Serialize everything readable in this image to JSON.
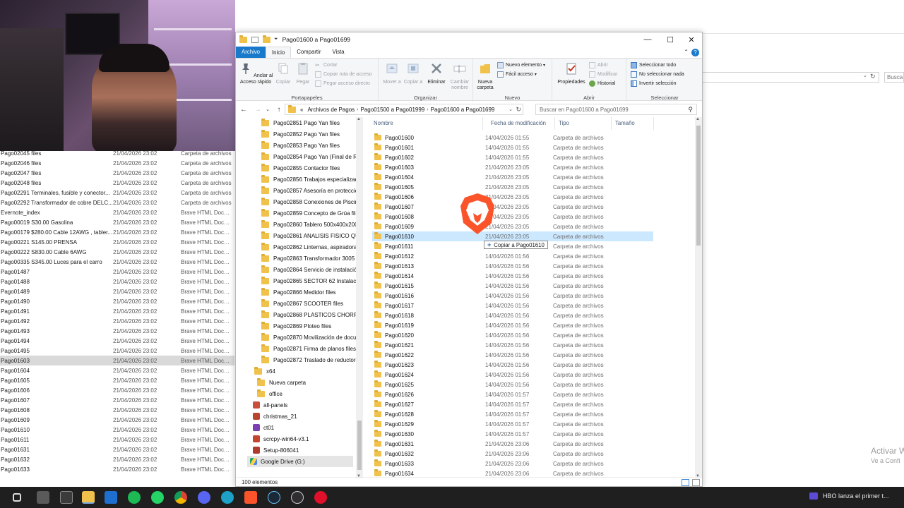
{
  "background_window": {
    "rows": [
      {
        "name": "Pago02045 files",
        "date": "21/04/2026 23:02",
        "type": "Carpeta de archivos"
      },
      {
        "name": "Pago02046 files",
        "date": "21/04/2026 23:02",
        "type": "Carpeta de archivos"
      },
      {
        "name": "Pago02047 files",
        "date": "21/04/2026 23:02",
        "type": "Carpeta de archivos"
      },
      {
        "name": "Pago02048 files",
        "date": "21/04/2026 23:02",
        "type": "Carpeta de archivos"
      },
      {
        "name": "Pago02291 Terminales, fusible y conector...",
        "date": "21/04/2026 23:02",
        "type": "Carpeta de archivos"
      },
      {
        "name": "Pago02292 Transformador de cobre DELC...",
        "date": "21/04/2026 23:02",
        "type": "Carpeta de archivos"
      },
      {
        "name": "Evernote_index",
        "date": "21/04/2026 23:02",
        "type": "Brave HTML Docu..."
      },
      {
        "name": "Pago00019 S30.00 Gasolina",
        "date": "21/04/2026 23:02",
        "type": "Brave HTML Docu..."
      },
      {
        "name": "Pago00179 $280.00 Cable 12AWG , tabler...",
        "date": "21/04/2026 23:02",
        "type": "Brave HTML Docu..."
      },
      {
        "name": "Pago00221 S145.00 PRENSA",
        "date": "21/04/2026 23:02",
        "type": "Brave HTML Docu..."
      },
      {
        "name": "Pago00222 S830.00 Cable 6AWG",
        "date": "21/04/2026 23:02",
        "type": "Brave HTML Docu..."
      },
      {
        "name": "Pago00335 S345.00 Luces para el carro",
        "date": "21/04/2026 23:02",
        "type": "Brave HTML Docu..."
      },
      {
        "name": "Pago01487",
        "date": "21/04/2026 23:02",
        "type": "Brave HTML Docu..."
      },
      {
        "name": "Pago01488",
        "date": "21/04/2026 23:02",
        "type": "Brave HTML Docu..."
      },
      {
        "name": "Pago01489",
        "date": "21/04/2026 23:02",
        "type": "Brave HTML Docu..."
      },
      {
        "name": "Pago01490",
        "date": "21/04/2026 23:02",
        "type": "Brave HTML Docu..."
      },
      {
        "name": "Pago01491",
        "date": "21/04/2026 23:02",
        "type": "Brave HTML Docu..."
      },
      {
        "name": "Pago01492",
        "date": "21/04/2026 23:02",
        "type": "Brave HTML Docu..."
      },
      {
        "name": "Pago01493",
        "date": "21/04/2026 23:02",
        "type": "Brave HTML Docu..."
      },
      {
        "name": "Pago01494",
        "date": "21/04/2026 23:02",
        "type": "Brave HTML Docu..."
      },
      {
        "name": "Pago01495",
        "date": "21/04/2026 23:02",
        "type": "Brave HTML Docu..."
      },
      {
        "name": "Pago01603",
        "date": "21/04/2026 23:02",
        "type": "Brave HTML Docu...",
        "selected": true
      },
      {
        "name": "Pago01604",
        "date": "21/04/2026 23:02",
        "type": "Brave HTML Docu..."
      },
      {
        "name": "Pago01605",
        "date": "21/04/2026 23:02",
        "type": "Brave HTML Docu..."
      },
      {
        "name": "Pago01606",
        "date": "21/04/2026 23:02",
        "type": "Brave HTML Docu..."
      },
      {
        "name": "Pago01607",
        "date": "21/04/2026 23:02",
        "type": "Brave HTML Docu..."
      },
      {
        "name": "Pago01608",
        "date": "21/04/2026 23:02",
        "type": "Brave HTML Docu..."
      },
      {
        "name": "Pago01609",
        "date": "21/04/2026 23:02",
        "type": "Brave HTML Docu..."
      },
      {
        "name": "Pago01610",
        "date": "21/04/2026 23:02",
        "type": "Brave HTML Docu..."
      },
      {
        "name": "Pago01611",
        "date": "21/04/2026 23:02",
        "type": "Brave HTML Docu..."
      },
      {
        "name": "Pago01631",
        "date": "21/04/2026 23:02",
        "type": "Brave HTML Docu..."
      },
      {
        "name": "Pago01632",
        "date": "21/04/2026 23:02",
        "type": "Brave HTML Docu..."
      },
      {
        "name": "Pago01633",
        "date": "21/04/2026 23:02",
        "type": "Brave HTML Docu..."
      }
    ],
    "search_placeholder": "Busca",
    "watermark_line1": "Activar W",
    "watermark_line2": "Ve a Confi"
  },
  "window": {
    "title": "Pago01600 a Pago01699",
    "minimize": "—",
    "maximize": "☐",
    "close": "✕"
  },
  "ribbon_tabs": [
    "Archivo",
    "Inicio",
    "Compartir",
    "Vista"
  ],
  "ribbon": {
    "portapapeles": {
      "label": "Portapapeles",
      "pin": "Anclar al Acceso rápido",
      "copy": "Copiar",
      "paste": "Pegar",
      "cut": "Cortar",
      "copy_path": "Copiar ruta de acceso",
      "paste_shortcut": "Pegar acceso directo"
    },
    "organizar": {
      "label": "Organizar",
      "move": "Mover a",
      "copy_to": "Copiar a",
      "delete": "Eliminar",
      "rename": "Cambiar nombre"
    },
    "nuevo": {
      "label": "Nuevo",
      "new_folder": "Nueva carpeta",
      "new_item": "Nuevo elemento",
      "easy_access": "Fácil acceso"
    },
    "abrir": {
      "label": "Abrir",
      "properties": "Propiedades",
      "open": "Abrir",
      "edit": "Modificar",
      "history": "Historial"
    },
    "seleccionar": {
      "label": "Seleccionar",
      "select_all": "Seleccionar todo",
      "select_none": "No seleccionar nada",
      "invert": "Invertir selección"
    }
  },
  "address": {
    "prefix": "«",
    "crumbs": [
      "Archivos de Pagos",
      "Pago01500 a Pago01999",
      "Pago01600 a Pago01699"
    ],
    "search_placeholder": "Buscar en Pago01600 a Pago01699"
  },
  "nav_tree": [
    {
      "label": "Pago02851 Pago Yan files",
      "kind": "folder"
    },
    {
      "label": "Pago02852 Pago Yan files",
      "kind": "folder"
    },
    {
      "label": "Pago02853 Pago Yan files",
      "kind": "folder"
    },
    {
      "label": "Pago02854 Pago Yan (Final de ROE",
      "kind": "folder"
    },
    {
      "label": "Pago02855 Contactor files",
      "kind": "folder"
    },
    {
      "label": "Pago02856 Trabajos especializado",
      "kind": "folder"
    },
    {
      "label": "Pago02857 Asesoría en protección",
      "kind": "folder"
    },
    {
      "label": "Pago02858 Conexiones de Piscina",
      "kind": "folder"
    },
    {
      "label": "Pago02859 Concepto de Grúa files",
      "kind": "folder"
    },
    {
      "label": "Pago02860 Tablero 500x400x200 , I",
      "kind": "folder"
    },
    {
      "label": "Pago02861 ANALISIS FISICO QUIM",
      "kind": "folder"
    },
    {
      "label": "Pago02862 Linternas, aspiradora, H",
      "kind": "folder"
    },
    {
      "label": "Pago02863 Transformador 3005 fil",
      "kind": "folder"
    },
    {
      "label": "Pago02864 Servicio de instalación",
      "kind": "folder"
    },
    {
      "label": "Pago02865 SECTOR 62 Instalación",
      "kind": "folder"
    },
    {
      "label": "Pago02866 Medidor files",
      "kind": "folder"
    },
    {
      "label": "Pago02867 SCOOTER files",
      "kind": "folder"
    },
    {
      "label": "Pago02868 PLASTICOS CHORRILL",
      "kind": "folder"
    },
    {
      "label": "Pago02869 Ploteo files",
      "kind": "folder"
    },
    {
      "label": "Pago02870 Movilización de docun",
      "kind": "folder"
    },
    {
      "label": "Pago02871 Firma de planos files",
      "kind": "folder"
    },
    {
      "label": "Pago02872 Traslado de reductores",
      "kind": "folder"
    },
    {
      "label": "x64",
      "kind": "folder"
    },
    {
      "label": "Nueva carpeta",
      "kind": "folder"
    },
    {
      "label": "office",
      "kind": "folder"
    },
    {
      "label": "all-panels",
      "kind": "app"
    },
    {
      "label": "christmas_21",
      "kind": "app"
    },
    {
      "label": "ct01",
      "kind": "app"
    },
    {
      "label": "scrcpy-win64-v3.1",
      "kind": "app"
    },
    {
      "label": "Setup-806041",
      "kind": "app"
    },
    {
      "label": "Google Drive (G:)",
      "kind": "drive"
    }
  ],
  "columns": {
    "name": "Nombre",
    "date": "Fecha de modificación",
    "type": "Tipo",
    "size": "Tamaño"
  },
  "files": [
    {
      "name": "Pago01600",
      "date": "14/04/2026 01:55",
      "type": "Carpeta de archivos"
    },
    {
      "name": "Pago01601",
      "date": "14/04/2026 01:55",
      "type": "Carpeta de archivos"
    },
    {
      "name": "Pago01602",
      "date": "14/04/2026 01:55",
      "type": "Carpeta de archivos"
    },
    {
      "name": "Pago01603",
      "date": "21/04/2026 23:05",
      "type": "Carpeta de archivos"
    },
    {
      "name": "Pago01604",
      "date": "21/04/2026 23:05",
      "type": "Carpeta de archivos"
    },
    {
      "name": "Pago01605",
      "date": "21/04/2026 23:05",
      "type": "Carpeta de archivos"
    },
    {
      "name": "Pago01606",
      "date": "21/04/2026 23:05",
      "type": "Carpeta de archivos"
    },
    {
      "name": "Pago01607",
      "date": "21/04/2026 23:05",
      "type": "Carpeta de archivos"
    },
    {
      "name": "Pago01608",
      "date": "21/04/2026 23:05",
      "type": "Carpeta de archivos"
    },
    {
      "name": "Pago01609",
      "date": "21/04/2026 23:05",
      "type": "Carpeta de archivos"
    },
    {
      "name": "Pago01610",
      "date": "21/04/2026 23:05",
      "type": "Carpeta de archivos",
      "selected": true
    },
    {
      "name": "Pago01611",
      "date": "21/04/2026 01:56",
      "type": "Carpeta de archivos"
    },
    {
      "name": "Pago01612",
      "date": "14/04/2026 01:56",
      "type": "Carpeta de archivos"
    },
    {
      "name": "Pago01613",
      "date": "14/04/2026 01:56",
      "type": "Carpeta de archivos"
    },
    {
      "name": "Pago01614",
      "date": "14/04/2026 01:56",
      "type": "Carpeta de archivos"
    },
    {
      "name": "Pago01615",
      "date": "14/04/2026 01:56",
      "type": "Carpeta de archivos"
    },
    {
      "name": "Pago01616",
      "date": "14/04/2026 01:56",
      "type": "Carpeta de archivos"
    },
    {
      "name": "Pago01617",
      "date": "14/04/2026 01:56",
      "type": "Carpeta de archivos"
    },
    {
      "name": "Pago01618",
      "date": "14/04/2026 01:56",
      "type": "Carpeta de archivos"
    },
    {
      "name": "Pago01619",
      "date": "14/04/2026 01:56",
      "type": "Carpeta de archivos"
    },
    {
      "name": "Pago01620",
      "date": "14/04/2026 01:56",
      "type": "Carpeta de archivos"
    },
    {
      "name": "Pago01621",
      "date": "14/04/2026 01:56",
      "type": "Carpeta de archivos"
    },
    {
      "name": "Pago01622",
      "date": "14/04/2026 01:56",
      "type": "Carpeta de archivos"
    },
    {
      "name": "Pago01623",
      "date": "14/04/2026 01:56",
      "type": "Carpeta de archivos"
    },
    {
      "name": "Pago01624",
      "date": "14/04/2026 01:56",
      "type": "Carpeta de archivos"
    },
    {
      "name": "Pago01625",
      "date": "14/04/2026 01:56",
      "type": "Carpeta de archivos"
    },
    {
      "name": "Pago01626",
      "date": "14/04/2026 01:57",
      "type": "Carpeta de archivos"
    },
    {
      "name": "Pago01627",
      "date": "14/04/2026 01:57",
      "type": "Carpeta de archivos"
    },
    {
      "name": "Pago01628",
      "date": "14/04/2026 01:57",
      "type": "Carpeta de archivos"
    },
    {
      "name": "Pago01629",
      "date": "14/04/2026 01:57",
      "type": "Carpeta de archivos"
    },
    {
      "name": "Pago01630",
      "date": "14/04/2026 01:57",
      "type": "Carpeta de archivos"
    },
    {
      "name": "Pago01631",
      "date": "21/04/2026 23:06",
      "type": "Carpeta de archivos"
    },
    {
      "name": "Pago01632",
      "date": "21/04/2026 23:06",
      "type": "Carpeta de archivos"
    },
    {
      "name": "Pago01633",
      "date": "21/04/2026 23:06",
      "type": "Carpeta de archivos"
    },
    {
      "name": "Pago01634",
      "date": "21/04/2026 23:06",
      "type": "Carpeta de archivos"
    }
  ],
  "drag": {
    "tooltip": "Copiar a Pago01610",
    "plus": "+",
    "ghost_icon": "brave-lion-icon"
  },
  "status": {
    "count": "100 elementos"
  },
  "taskbar": {
    "icons": [
      "task-view-icon",
      "file-explorer-icon",
      "calculator-icon",
      "folder-icon",
      "mail-icon",
      "spotify-icon",
      "whatsapp-icon",
      "chrome-icon",
      "discord-icon",
      "edge-icon",
      "brave-icon",
      "steam-icon",
      "obs-icon",
      "opera-icon"
    ],
    "notification": "HBO lanza el primer t..."
  },
  "colors": {
    "accent": "#1979ca",
    "selection": "#cce8ff",
    "folder": "#f0c24b",
    "brave": "#fb542b",
    "taskbar": "#1f1f1f"
  }
}
